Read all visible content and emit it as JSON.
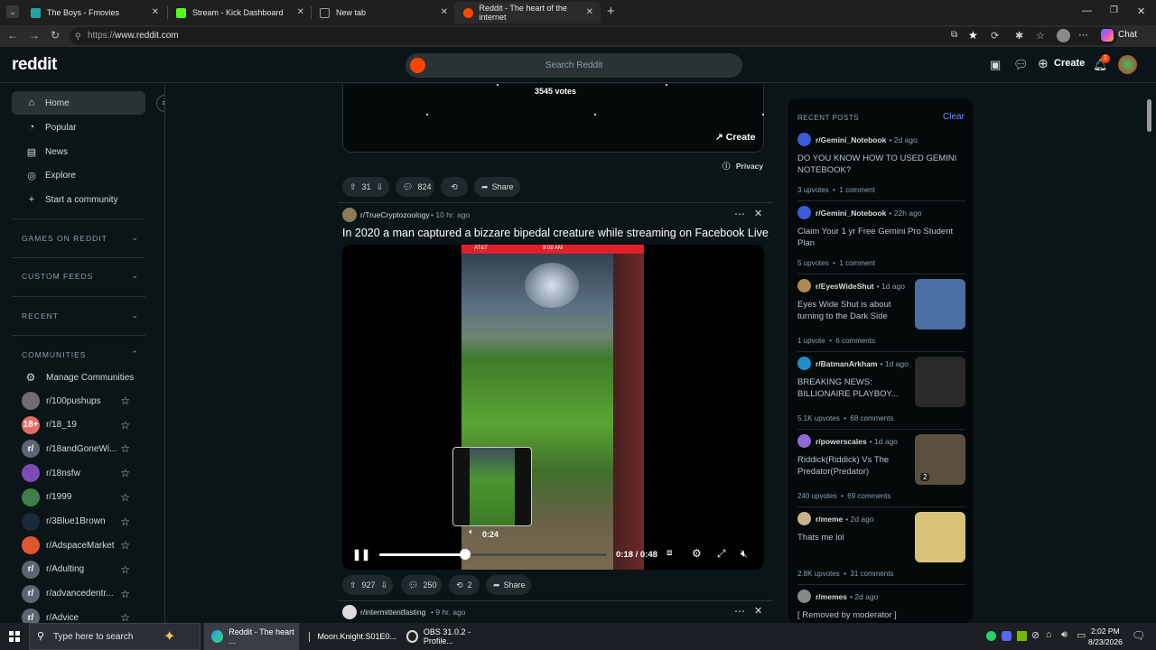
{
  "browser": {
    "tabs": [
      {
        "title": "The Boys - Fmovies",
        "color": "#1fa3a3"
      },
      {
        "title": "Stream - Kick Dashboard",
        "color": "#53fc18"
      },
      {
        "title": "New tab",
        "color": "#9aa0a6"
      },
      {
        "title": "Reddit - The heart of the internet",
        "color": "#ff4500"
      }
    ],
    "url_prefix": "https://",
    "url_host": "www.reddit.com",
    "chat_label": "Chat"
  },
  "header": {
    "logo": "reddit",
    "search_placeholder": "Search Reddit",
    "create_label": "Create",
    "notif_count": "1"
  },
  "sidebar": {
    "nav": [
      {
        "label": "Home",
        "icon": "home-icon"
      },
      {
        "label": "Popular",
        "icon": "popular-icon"
      },
      {
        "label": "News",
        "icon": "news-icon"
      },
      {
        "label": "Explore",
        "icon": "explore-icon"
      },
      {
        "label": "Start a community",
        "icon": "plus-icon"
      }
    ],
    "sections": [
      "GAMES ON REDDIT",
      "CUSTOM FEEDS",
      "RECENT",
      "COMMUNITIES"
    ],
    "manage_label": "Manage Communities",
    "communities": [
      {
        "name": "r/100pushups",
        "color": "#6e6e6e",
        "glyph": ""
      },
      {
        "name": "r/18_19",
        "color": "#e26a6a",
        "glyph": "18+"
      },
      {
        "name": "r/18andGoneWi...",
        "color": "#5a6770",
        "glyph": "r/"
      },
      {
        "name": "r/18nsfw",
        "color": "#7b4bb7",
        "glyph": ""
      },
      {
        "name": "r/1999",
        "color": "#3f7d4a",
        "glyph": ""
      },
      {
        "name": "r/3Blue1Brown",
        "color": "#1b2a3a",
        "glyph": ""
      },
      {
        "name": "r/AdspaceMarket",
        "color": "#e2562f",
        "glyph": ""
      },
      {
        "name": "r/Adulting",
        "color": "#5a6770",
        "glyph": "r/"
      },
      {
        "name": "r/advancedentr...",
        "color": "#5a6770",
        "glyph": "r/"
      },
      {
        "name": "r/Advice",
        "color": "#5a6770",
        "glyph": "r/"
      }
    ]
  },
  "poll": {
    "votes": "3545 votes",
    "create_label": "Create",
    "privacy_label": "Privacy",
    "upvotes": "31",
    "comments": "824",
    "share_label": "Share"
  },
  "post": {
    "subreddit": "r/TrueCryptozoology",
    "age": "10 hr. ago",
    "title": "In 2020 a man captured a bizzare bipedal creature while streaming on Facebook Live",
    "phone_carrier": "AT&T",
    "phone_time": "9:08 AM",
    "hover_time": "0:24",
    "time_display": "0:18 / 0:48",
    "progress": 0.375,
    "upvotes": "927",
    "comments": "250",
    "reposts": "2",
    "share_label": "Share"
  },
  "next_post": {
    "subreddit": "r/intermittentfasting",
    "age": "9 hr. ago"
  },
  "recent": {
    "heading": "RECENT POSTS",
    "clear_label": "Clear",
    "posts": [
      {
        "sub": "r/Gemini_Notebook",
        "age": "• 2d ago",
        "title": "DO YOU KNOW HOW TO USED GEMINI NOTEBOOK?",
        "upvotes": "3 upvotes",
        "comments": "1 comment",
        "thumb": "",
        "avatar": "#3b5bdb"
      },
      {
        "sub": "r/Gemini_Notebook",
        "age": "• 22h ago",
        "title": "Claim Your 1 yr Free Gemini Pro Student Plan",
        "upvotes": "5 upvotes",
        "comments": "1 comment",
        "thumb": "",
        "avatar": "#3b5bdb"
      },
      {
        "sub": "r/EyesWideShut",
        "age": "• 1d ago",
        "title": "Eyes Wide Shut is about turning to the Dark Side",
        "upvotes": "1 upvote",
        "comments": "6 comments",
        "thumb": "#4a6fa5",
        "avatar": "#b08a4a"
      },
      {
        "sub": "r/BatmanArkham",
        "age": "• 1d ago",
        "title": "BREAKING NEWS: BILLIONAIRE PLAYBOY...",
        "upvotes": "5.1K upvotes",
        "comments": "68 comments",
        "thumb": "#2a2a2a",
        "avatar": "#1f8fc9"
      },
      {
        "sub": "r/powerscales",
        "age": "• 1d ago",
        "title": "Riddick(Riddick) Vs The Predator(Predator)",
        "upvotes": "240 upvotes",
        "comments": "69 comments",
        "thumb": "#5b5040",
        "avatar": "#8c6bd6"
      },
      {
        "sub": "r/meme",
        "age": "• 2d ago",
        "title": "Thats me lol",
        "upvotes": "2.8K upvotes",
        "comments": "31 comments",
        "thumb": "#d9c27a",
        "avatar": "#c8b48a"
      },
      {
        "sub": "r/memes",
        "age": "• 2d ago",
        "title": "[ Removed by moderator ]",
        "upvotes": "",
        "comments": "",
        "thumb": "",
        "avatar": "#888888"
      }
    ],
    "thumb_badge": "2"
  },
  "taskbar": {
    "search_placeholder": "Type here to search",
    "apps": [
      "Reddit - The heart ...",
      "Moon.Knight.S01E0...",
      "OBS 31.0.2 - Profile..."
    ],
    "time": "2:02 PM",
    "date": "8/23/2026"
  }
}
